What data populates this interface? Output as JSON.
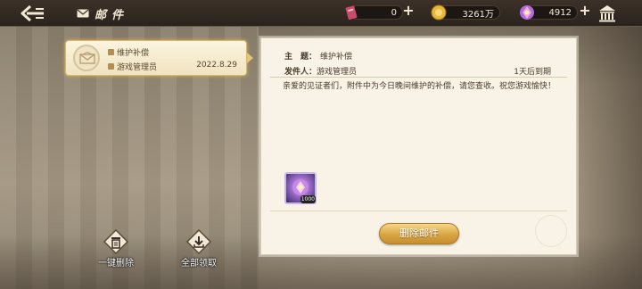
{
  "header": {
    "title": "邮件",
    "currencies": [
      {
        "icon": "ticket-icon",
        "value": "0"
      },
      {
        "icon": "gold-coin-icon",
        "value": "3261万"
      },
      {
        "icon": "crystal-icon",
        "value": "4912"
      }
    ]
  },
  "mail_list": [
    {
      "title": "维护补偿",
      "sender": "游戏管理员",
      "date": "2022.8.29",
      "selected": true
    }
  ],
  "detail": {
    "subject_label": "主　题：",
    "subject": "维护补偿",
    "sender_label": "发件人：",
    "sender": "游戏管理员",
    "expiry": "1天后到期",
    "body": "亲爱的见证者们，附件中为今日晚间维护的补偿，请您查收。祝您游戏愉快！",
    "attachment": {
      "icon": "crystal-item-icon",
      "count": "1000"
    },
    "delete_label": "删除邮件"
  },
  "actions": {
    "delete_all": "一键删除",
    "claim_all": "全部领取"
  },
  "colors": {
    "accent_gold": "#d8a544",
    "panel_bg": "#f8f3e6",
    "topbar_bg": "#2a231d"
  }
}
